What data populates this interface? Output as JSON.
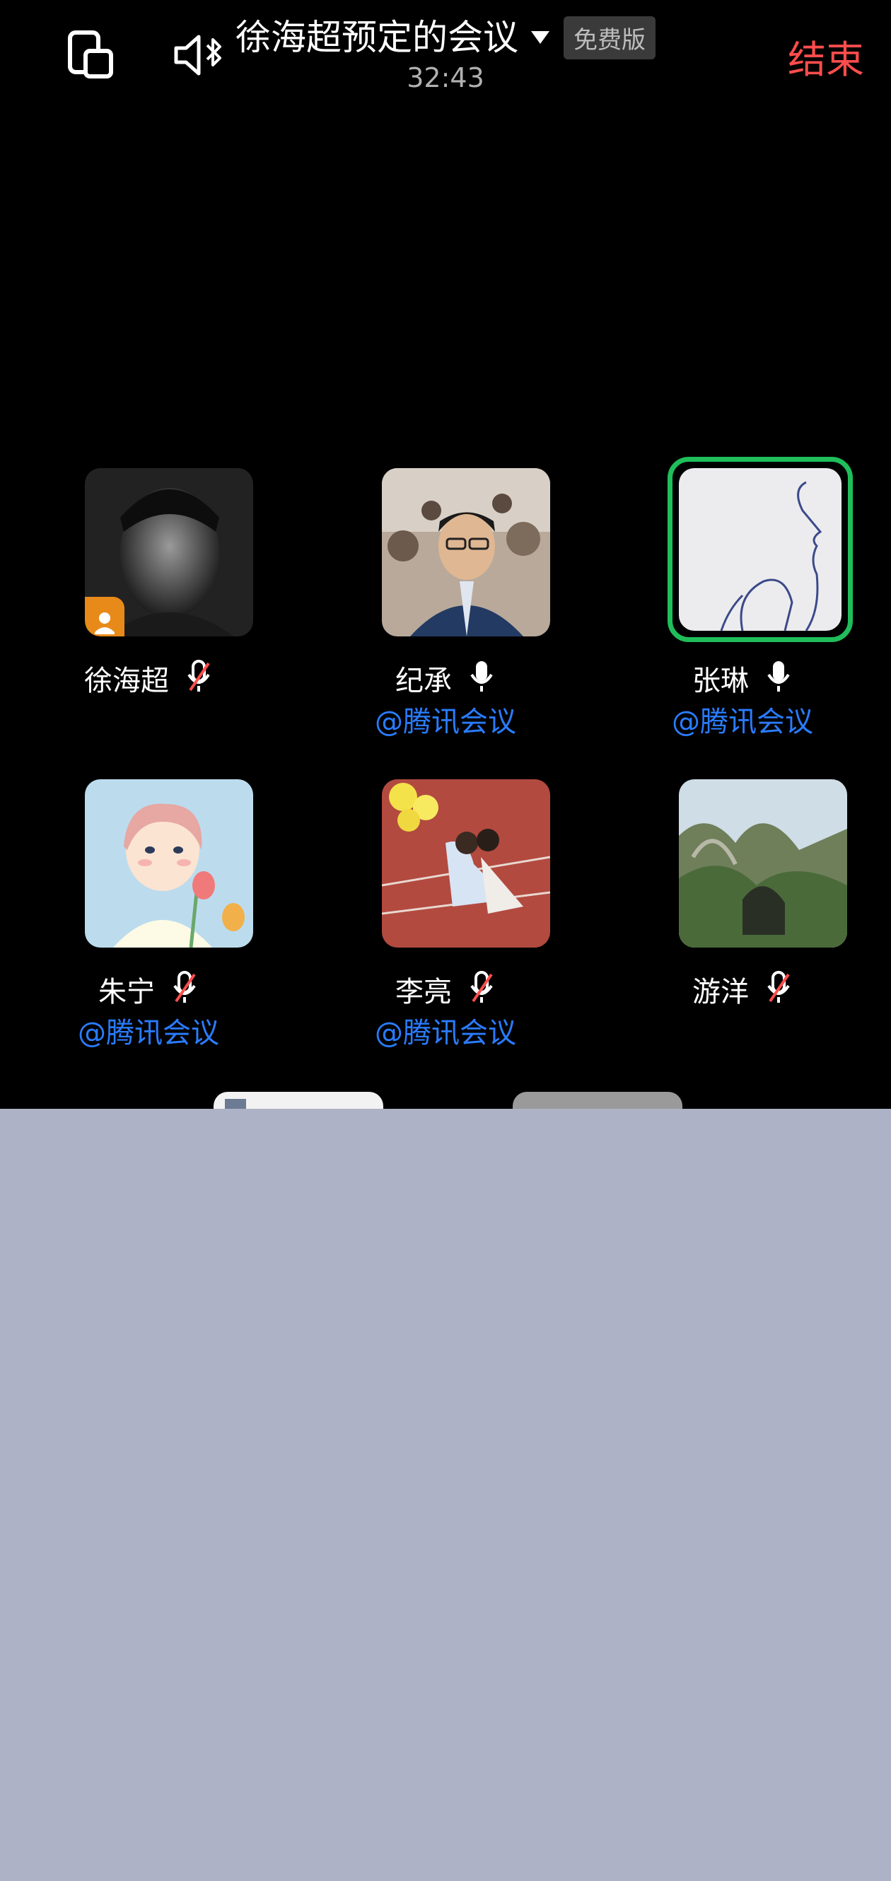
{
  "header": {
    "title": "徐海超预定的会议",
    "badge": "免费版",
    "timer": "32:43",
    "end_label": "结束"
  },
  "participants": [
    {
      "name": "徐海超",
      "org": "",
      "mic": "muted",
      "host": true,
      "speaking": false
    },
    {
      "name": "纪承",
      "org": "@腾讯会议",
      "mic": "on",
      "host": false,
      "speaking": false
    },
    {
      "name": "张琳",
      "org": "@腾讯会议",
      "mic": "on",
      "host": false,
      "speaking": true
    },
    {
      "name": "朱宁",
      "org": "@腾讯会议",
      "mic": "muted",
      "host": false,
      "speaking": false
    },
    {
      "name": "李亮",
      "org": "@腾讯会议",
      "mic": "muted",
      "host": false,
      "speaking": false
    },
    {
      "name": "游洋",
      "org": "",
      "mic": "muted",
      "host": false,
      "speaking": false
    }
  ],
  "colors": {
    "end": "#ff4d4d",
    "org": "#2a7cff",
    "speaking_border": "#1fbe5b",
    "host_badge": "#e88a1a",
    "panel": "#adb2c6"
  }
}
